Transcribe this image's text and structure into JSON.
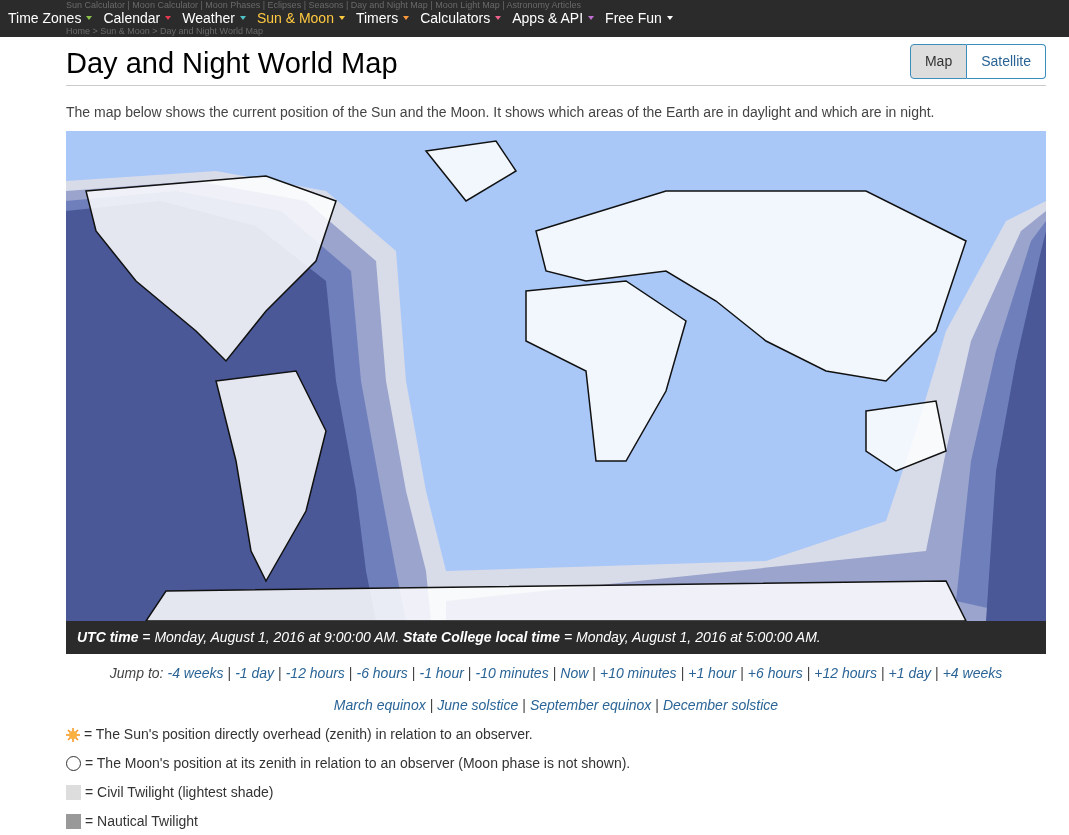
{
  "subnav": "Sun Calculator | Moon Calculator | Moon Phases | Eclipses | Seasons | Day and Night Map | Moon Light Map | Astronomy Articles",
  "breadcrumb": "Home > Sun & Moon > Day and Night World Map",
  "nav": [
    {
      "label": "Time Zones",
      "color": "#8bc34a",
      "selected": false
    },
    {
      "label": "Calendar",
      "color": "#e53950",
      "selected": false
    },
    {
      "label": "Weather",
      "color": "#4fc3c7",
      "selected": false
    },
    {
      "label": "Sun & Moon",
      "color": "#ffc940",
      "selected": true
    },
    {
      "label": "Timers",
      "color": "#ff9a3c",
      "selected": false
    },
    {
      "label": "Calculators",
      "color": "#f0608a",
      "selected": false
    },
    {
      "label": "Apps & API",
      "color": "#c070d0",
      "selected": false
    },
    {
      "label": "Free Fun",
      "color": "#ffffff",
      "selected": false
    }
  ],
  "title": "Day and Night World Map",
  "view_toggle": [
    {
      "label": "Map",
      "selected": true
    },
    {
      "label": "Satellite",
      "selected": false
    }
  ],
  "intro": "The map below shows the current position of the Sun and the Moon. It shows which areas of the Earth are in daylight and which are in night.",
  "caption": "**UTC time** = Monday, August 1, 2016 at 9:00:00 AM. **State College local time** = Monday, August 1, 2016 at 5:00:00 AM.",
  "jump_label": "Jump to:",
  "link_separator": "|",
  "jump_links": [
    "-4 weeks",
    "-1 day",
    "-12 hours",
    "-6 hours",
    "-1 hour",
    "-10 minutes",
    "Now",
    "+10 minutes",
    "+1 hour",
    "+6 hours",
    "+12 hours",
    "+1 day",
    "+4 weeks"
  ],
  "season_links": [
    "March equinox",
    "June solstice",
    "September equinox",
    "December solstice"
  ],
  "legend": [
    {
      "kind": "sun",
      "text": "= The Sun's position directly overhead (zenith) in relation to an observer."
    },
    {
      "kind": "moon",
      "text": "= The Moon's position at its zenith in relation to an observer (Moon phase is not shown)."
    },
    {
      "kind": "civil",
      "text": "= Civil Twilight (lightest shade)"
    },
    {
      "kind": "nautical",
      "text": "= Nautical Twilight"
    }
  ]
}
